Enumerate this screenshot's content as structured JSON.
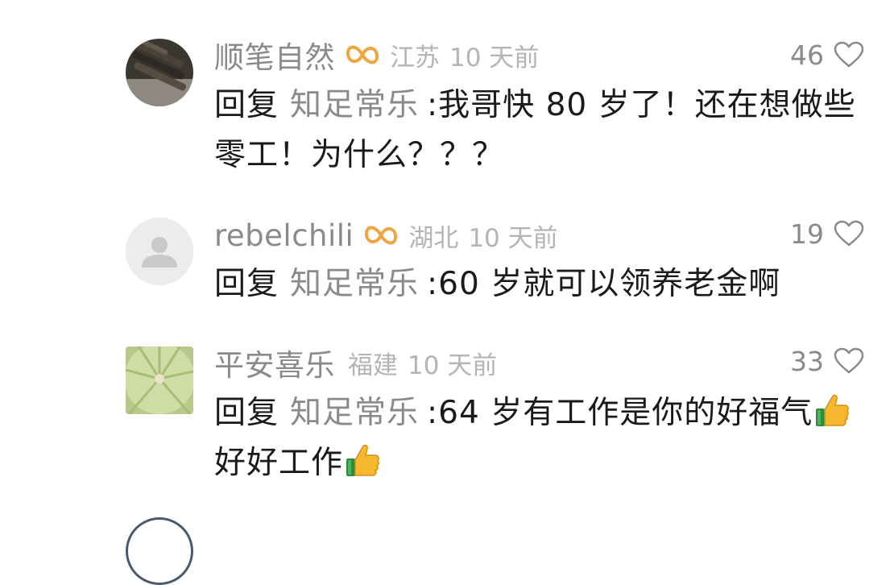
{
  "comments": [
    {
      "username": "顺笔自然",
      "region": "江苏",
      "time": "10 天前",
      "likes": "46",
      "reply_word": "回复",
      "reply_target": "知足常乐",
      "text": ":我哥快 80 岁了！还在想做些零工！为什么？？？",
      "has_badge": true,
      "avatar": "dark-photo-avatar"
    },
    {
      "username": "rebelchili",
      "region": "湖北",
      "time": "10 天前",
      "likes": "19",
      "reply_word": "回复",
      "reply_target": "知足常乐",
      "text": ":60 岁就可以领养老金啊",
      "has_badge": true,
      "avatar": "default-user-avatar"
    },
    {
      "username": "平安喜乐",
      "region": "福建",
      "time": "10 天前",
      "likes": "33",
      "reply_word": "回复",
      "reply_target": "知足常乐",
      "text_part1": ":64 岁有工作是你的好福气",
      "text_part2": "好好工作",
      "has_badge": false,
      "avatar": "melon-photo-avatar",
      "emoji": "thumbs-up-icon"
    }
  ],
  "colors": {
    "username": "#8a8a8a",
    "meta": "#b4b4b4",
    "body": "#1a1a1a",
    "badge": "#f0a640",
    "heart_stroke": "#8a8a8a"
  },
  "icons": {
    "badge": "infinity-badge-icon",
    "like": "heart-outline-icon"
  }
}
